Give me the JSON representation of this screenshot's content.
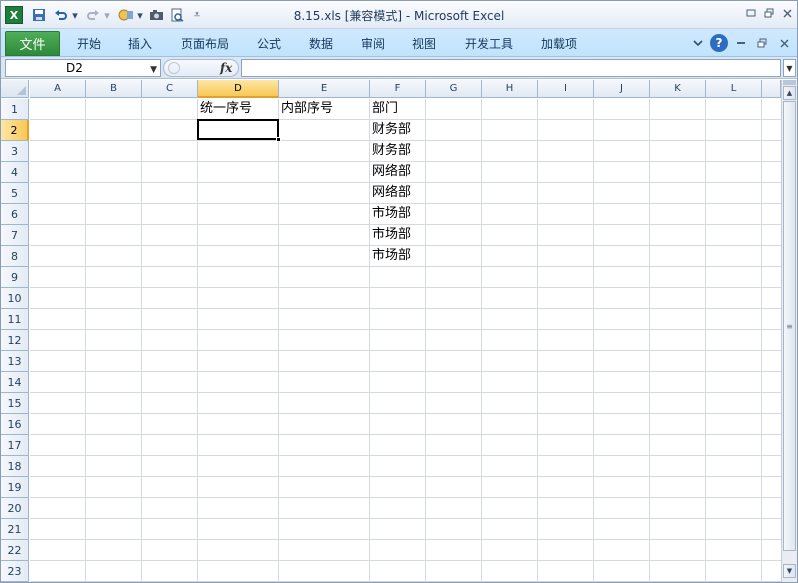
{
  "window": {
    "title": "8.15.xls  [兼容模式]  -  Microsoft Excel",
    "app_icon": "excel-icon"
  },
  "quick_access": {
    "save": "save-icon",
    "undo": "undo-icon",
    "redo": "redo-icon",
    "tools": "tools-icon",
    "camera": "camera-icon",
    "print_preview": "print-preview-icon",
    "customize": "customize-icon"
  },
  "ribbon": {
    "file_tab": "文件",
    "tabs": [
      "开始",
      "插入",
      "页面布局",
      "公式",
      "数据",
      "审阅",
      "视图",
      "开发工具",
      "加载项"
    ]
  },
  "formula_bar": {
    "name_box": "D2",
    "fx_label": "fx",
    "formula": ""
  },
  "sheet": {
    "columns": [
      "A",
      "B",
      "C",
      "D",
      "E",
      "F",
      "G",
      "H",
      "I",
      "J",
      "K",
      "L"
    ],
    "active_column": "D",
    "rows": [
      "1",
      "2",
      "3",
      "4",
      "5",
      "6",
      "7",
      "8",
      "9",
      "10",
      "11",
      "12",
      "13",
      "14",
      "15",
      "16",
      "17",
      "18",
      "19",
      "20",
      "21",
      "22",
      "23"
    ],
    "active_row": "2",
    "cells": {
      "D1": "统一序号",
      "E1": "内部序号",
      "F1": "部门",
      "F2": "财务部",
      "F3": "财务部",
      "F4": "网络部",
      "F5": "网络部",
      "F6": "市场部",
      "F7": "市场部",
      "F8": "市场部"
    }
  },
  "colors": {
    "accent_green": "#2e8a3b",
    "ribbon_blue": "#c0e3fb",
    "active_header": "#f8c856",
    "grid_line": "#d4d9e0"
  }
}
